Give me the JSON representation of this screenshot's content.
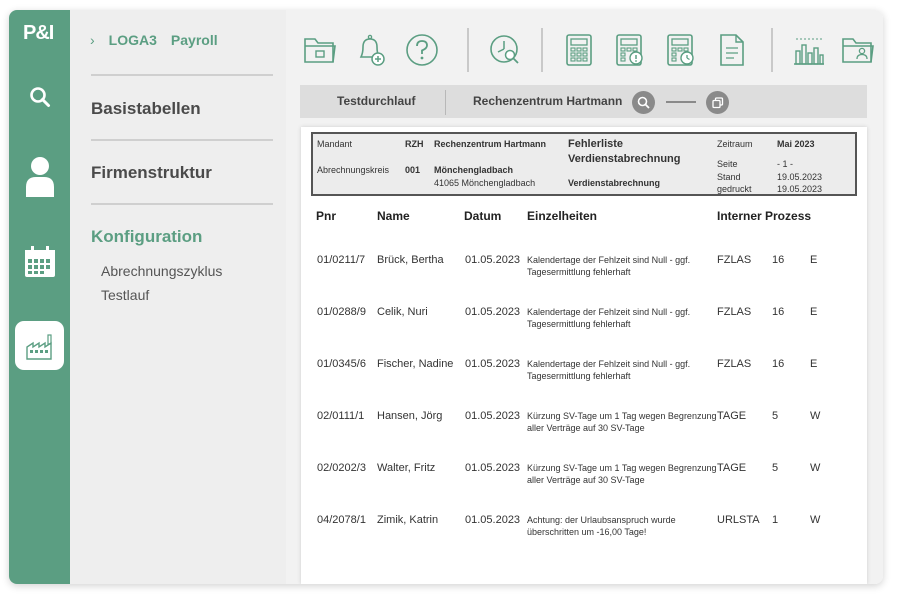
{
  "app": {
    "logo": "P&I"
  },
  "rail": {
    "items": [
      {
        "icon": "search-icon"
      },
      {
        "icon": "user-icon"
      },
      {
        "icon": "calendar-icon"
      },
      {
        "icon": "factory-icon",
        "active": true
      }
    ]
  },
  "nav": {
    "breadcrumb": {
      "chevron": "›",
      "product": "LOGA3",
      "module": "Payroll"
    },
    "sections": [
      {
        "label": "Basistabellen"
      },
      {
        "label": "Firmenstruktur"
      },
      {
        "label": "Konfiguration",
        "active": true
      }
    ],
    "sub_items": [
      "Abrechnungszyklus",
      "Testlauf"
    ]
  },
  "toolbar": {
    "icons": [
      "folder-icon",
      "bell-add-icon",
      "help-icon",
      "clock-search-icon",
      "calculator-icon",
      "calculator-warning-icon",
      "calculator-clock-icon",
      "document-icon",
      "bar-chart-icon",
      "folder-user-icon"
    ]
  },
  "tabs": {
    "first": "Testdurchlauf",
    "second": "Rechenzentrum Hartmann"
  },
  "report": {
    "header": {
      "mandant_label": "Mandant",
      "mandant_code": "RZH",
      "mandant_name": "Rechenzentrum Hartmann",
      "kreis_label": "Abrechnungskreis",
      "kreis_code": "001",
      "kreis_city": "Mönchengladbach",
      "kreis_address": "41065 Mönchengladbach",
      "title_line1": "Fehlerliste",
      "title_line2": "Verdienstabrechnung",
      "subtitle": "Verdienstabrechnung",
      "zeitraum_label": "Zeitraum",
      "zeitraum_value": "Mai 2023",
      "seite_label": "Seite",
      "seite_value": "- 1 -",
      "stand_label": "Stand",
      "stand_value": "19.05.2023",
      "gedruckt_label": "gedruckt",
      "gedruckt_value": "19.05.2023"
    },
    "columns": {
      "pnr": "Pnr",
      "name": "Name",
      "datum": "Datum",
      "details": "Einzelheiten",
      "process": "Interner Prozess"
    },
    "rows": [
      {
        "pnr": "01/0211/7",
        "name": "Brück, Bertha",
        "datum": "01.05.2023",
        "details": "Kalendertage der Fehlzeit sind Null - ggf. Tagesermittlung fehlerhaft",
        "code": "FZLAS",
        "num": "16",
        "type": "E"
      },
      {
        "pnr": "01/0288/9",
        "name": "Celik, Nuri",
        "datum": "01.05.2023",
        "details": "Kalendertage der Fehlzeit sind Null - ggf. Tagesermittlung fehlerhaft",
        "code": "FZLAS",
        "num": "16",
        "type": "E"
      },
      {
        "pnr": "01/0345/6",
        "name": "Fischer, Nadine",
        "datum": "01.05.2023",
        "details": "Kalendertage der Fehlzeit sind Null - ggf. Tagesermittlung fehlerhaft",
        "code": "FZLAS",
        "num": "16",
        "type": "E"
      },
      {
        "pnr": "02/0111/1",
        "name": "Hansen, Jörg",
        "datum": "01.05.2023",
        "details": "Kürzung SV-Tage um 1 Tag wegen Begrenzung aller Verträge auf 30 SV-Tage",
        "code": "TAGE",
        "num": "5",
        "type": "W"
      },
      {
        "pnr": "02/0202/3",
        "name": "Walter, Fritz",
        "datum": "01.05.2023",
        "details": "Kürzung SV-Tage um 1 Tag wegen Begrenzung aller Verträge auf 30 SV-Tage",
        "code": "TAGE",
        "num": "5",
        "type": "W"
      },
      {
        "pnr": "04/2078/1",
        "name": "Zimik, Katrin",
        "datum": "01.05.2023",
        "details": "Achtung: der Urlaubsanspruch wurde überschritten um -16,00 Tage!",
        "code": "URLSTA",
        "num": "1",
        "type": "W"
      }
    ]
  },
  "colors": {
    "brand": "#5b9e82",
    "nav_bg": "#eeeeee",
    "main_bg": "#f2f2f2"
  }
}
